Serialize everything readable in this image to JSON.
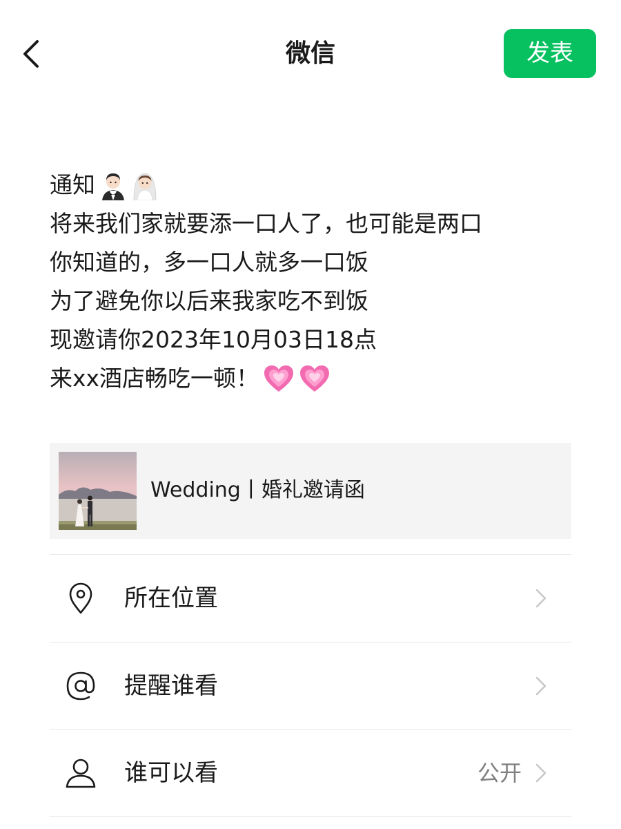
{
  "header": {
    "title": "微信",
    "publish_label": "发表"
  },
  "post": {
    "lines": [
      "通知",
      "将来我们家就要添一口人了，也可能是两口",
      "你知道的，多一口人就多一口饭",
      "为了避免你以后来我家吃不到饭",
      "现邀请你2023年10月03日18点",
      "来xx酒店畅吃一顿！"
    ],
    "line1_emojis": [
      "groom-emoji",
      "bride-emoji"
    ],
    "line6_emojis": [
      "growing-heart-emoji",
      "growing-heart-emoji"
    ]
  },
  "link_card": {
    "title": "Wedding丨婚礼邀请函",
    "thumbnail": "wedding-photo"
  },
  "options": [
    {
      "label": "所在位置",
      "icon": "location-pin-icon",
      "value": ""
    },
    {
      "label": "提醒谁看",
      "icon": "at-icon",
      "value": ""
    },
    {
      "label": "谁可以看",
      "icon": "person-icon",
      "value": "公开"
    }
  ],
  "colors": {
    "accent": "#07c160",
    "card_bg": "#f4f4f4",
    "secondary_text": "#808080",
    "divider": "#e6e6e6"
  }
}
